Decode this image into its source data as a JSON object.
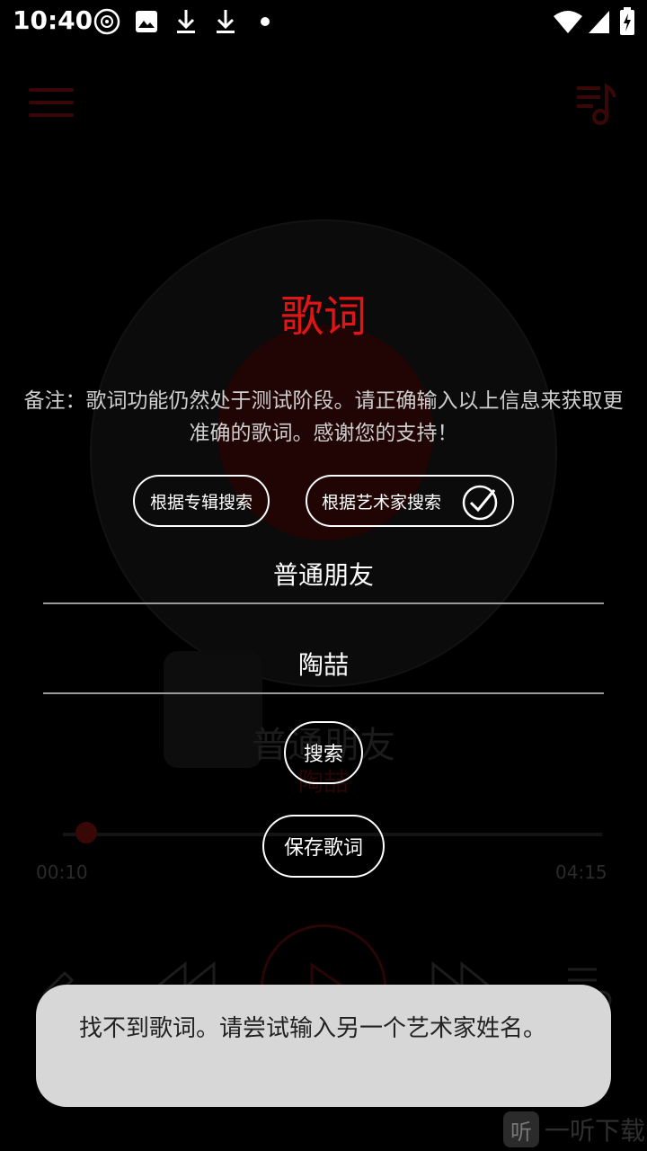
{
  "status_bar": {
    "time": "10:40",
    "icons": [
      "cd-icon",
      "image-icon",
      "download-icon",
      "download-icon",
      "dot-icon",
      "wifi-icon",
      "signal-icon",
      "battery-icon"
    ]
  },
  "background_player": {
    "song_title": "普通朋友",
    "artist": "陶喆",
    "time_current": "00:10",
    "time_total": "04:15"
  },
  "dialog": {
    "title": "歌词",
    "note": "备注：歌词功能仍然处于测试阶段。请正确输入以上信息来获取更准确的歌词。感谢您的支持！",
    "search_by_album_label": "根据专辑搜索",
    "search_by_artist_label": "根据艺术家搜索",
    "search_by_artist_selected": true,
    "song_field_value": "普通朋友",
    "artist_field_value": "陶喆",
    "search_button_label": "搜索",
    "save_button_label": "保存歌词"
  },
  "toast": {
    "message": "找不到歌词。请尝试输入另一个艺术家姓名。"
  },
  "watermark": {
    "logo_char": "听",
    "text": "一听下载"
  },
  "colors": {
    "accent": "#e01515",
    "toast_bg": "#d7d7d7",
    "background": "#000000"
  }
}
